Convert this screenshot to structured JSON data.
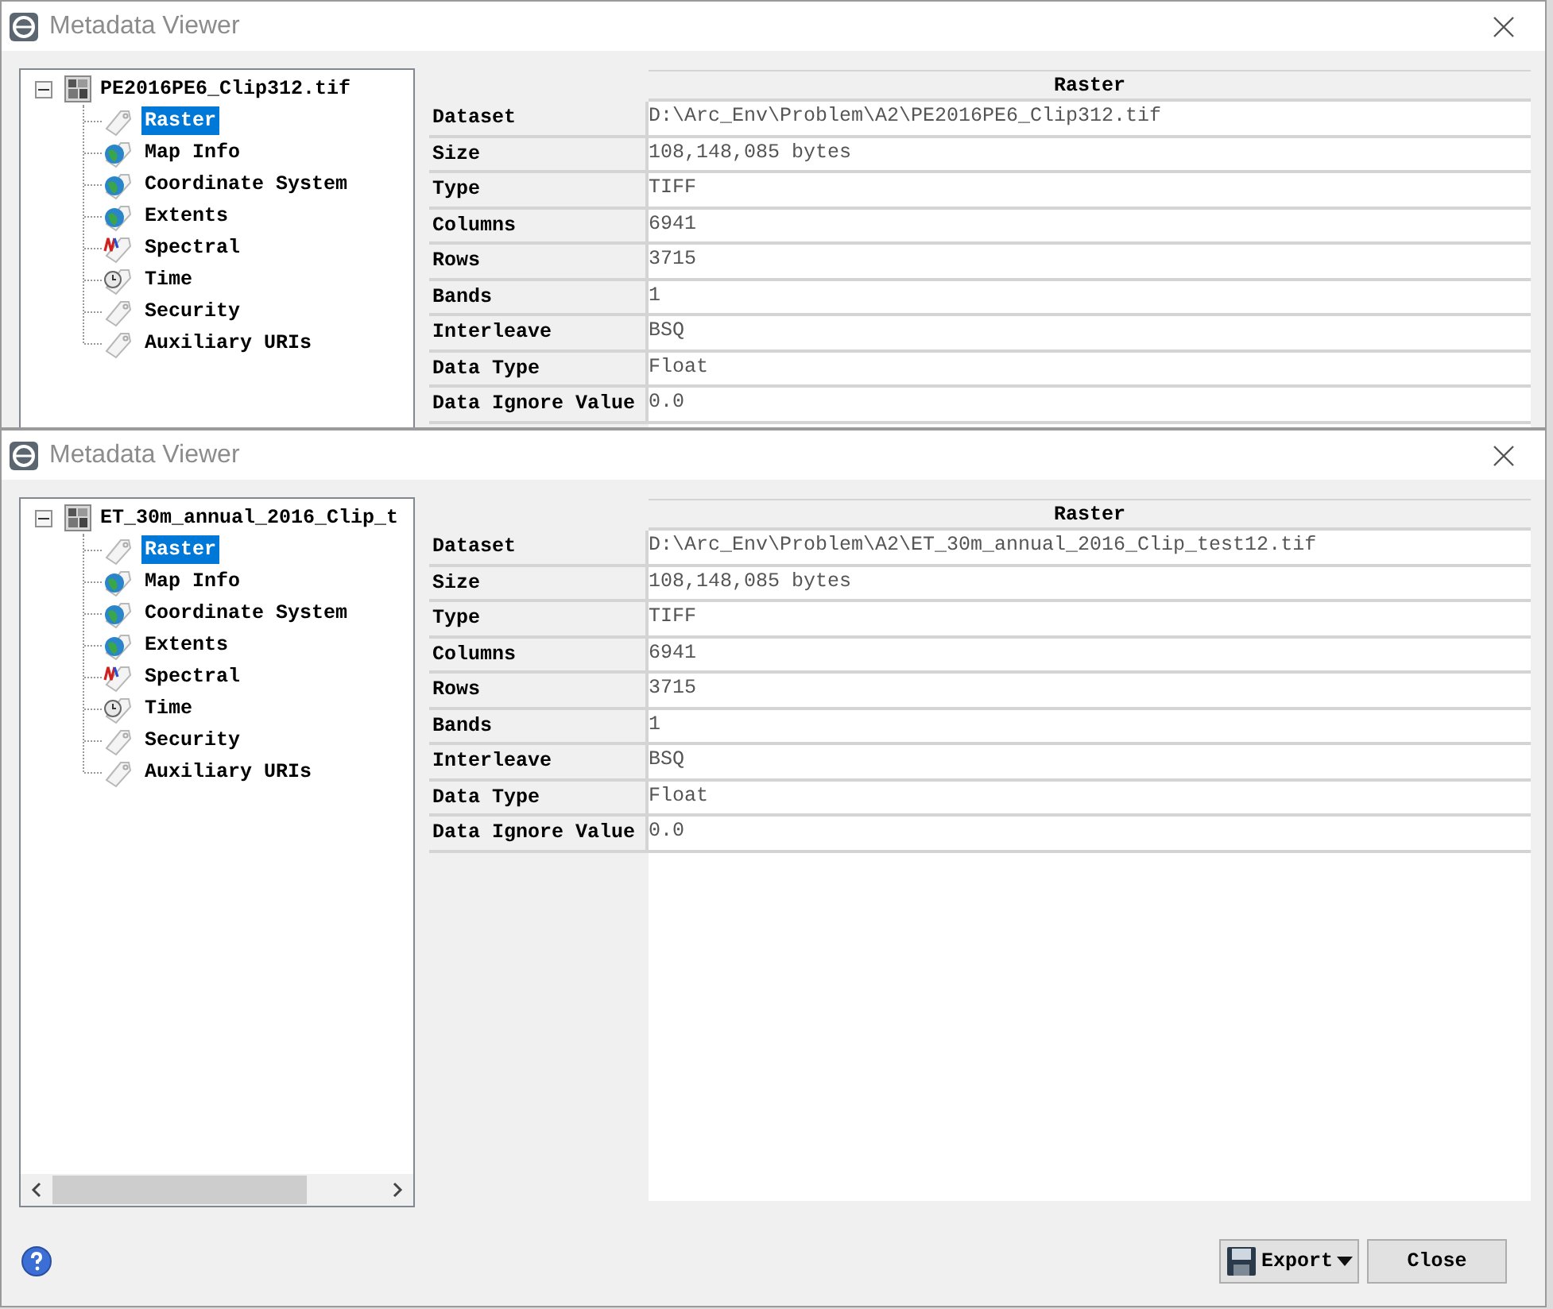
{
  "windows": [
    {
      "title": "Metadata Viewer",
      "tree": {
        "label": "PE2016PE6_Clip312.tif",
        "expanded": true,
        "children": [
          {
            "label": "Raster",
            "kind": "tag",
            "selected": true
          },
          {
            "label": "Map Info",
            "kind": "globe",
            "selected": false
          },
          {
            "label": "Coordinate System",
            "kind": "globe",
            "selected": false
          },
          {
            "label": "Extents",
            "kind": "globe",
            "selected": false
          },
          {
            "label": "Spectral",
            "kind": "spectral",
            "selected": false
          },
          {
            "label": "Time",
            "kind": "clock",
            "selected": false
          },
          {
            "label": "Security",
            "kind": "tag",
            "selected": false
          },
          {
            "label": "Auxiliary URIs",
            "kind": "tag",
            "selected": false
          }
        ]
      },
      "table": {
        "header": "Raster",
        "rows": [
          {
            "label": "Dataset",
            "value": "D:\\Arc_Env\\Problem\\A2\\PE2016PE6_Clip312.tif"
          },
          {
            "label": "Size",
            "value": "108,148,085 bytes"
          },
          {
            "label": "Type",
            "value": "TIFF"
          },
          {
            "label": "Columns",
            "value": "6941"
          },
          {
            "label": "Rows",
            "value": "3715"
          },
          {
            "label": "Bands",
            "value": "1"
          },
          {
            "label": "Interleave",
            "value": "BSQ"
          },
          {
            "label": "Data Type",
            "value": "Float"
          },
          {
            "label": "Data Ignore Value",
            "value": "0.0"
          }
        ]
      }
    },
    {
      "title": "Metadata Viewer",
      "tree": {
        "label": "ET_30m_annual_2016_Clip_t",
        "expanded": true,
        "children": [
          {
            "label": "Raster",
            "kind": "tag",
            "selected": true
          },
          {
            "label": "Map Info",
            "kind": "globe",
            "selected": false
          },
          {
            "label": "Coordinate System",
            "kind": "globe",
            "selected": false
          },
          {
            "label": "Extents",
            "kind": "globe",
            "selected": false
          },
          {
            "label": "Spectral",
            "kind": "spectral",
            "selected": false
          },
          {
            "label": "Time",
            "kind": "clock",
            "selected": false
          },
          {
            "label": "Security",
            "kind": "tag",
            "selected": false
          },
          {
            "label": "Auxiliary URIs",
            "kind": "tag",
            "selected": false
          }
        ]
      },
      "table": {
        "header": "Raster",
        "rows": [
          {
            "label": "Dataset",
            "value": "D:\\Arc_Env\\Problem\\A2\\ET_30m_annual_2016_Clip_test12.tif"
          },
          {
            "label": "Size",
            "value": "108,148,085 bytes"
          },
          {
            "label": "Type",
            "value": "TIFF"
          },
          {
            "label": "Columns",
            "value": "6941"
          },
          {
            "label": "Rows",
            "value": "3715"
          },
          {
            "label": "Bands",
            "value": "1"
          },
          {
            "label": "Interleave",
            "value": "BSQ"
          },
          {
            "label": "Data Type",
            "value": "Float"
          },
          {
            "label": "Data Ignore Value",
            "value": "0.0"
          }
        ]
      },
      "footer": {
        "buttons": [
          {
            "label": "Export",
            "kind": "menu"
          },
          {
            "label": "Close",
            "kind": "plain"
          }
        ]
      }
    }
  ]
}
